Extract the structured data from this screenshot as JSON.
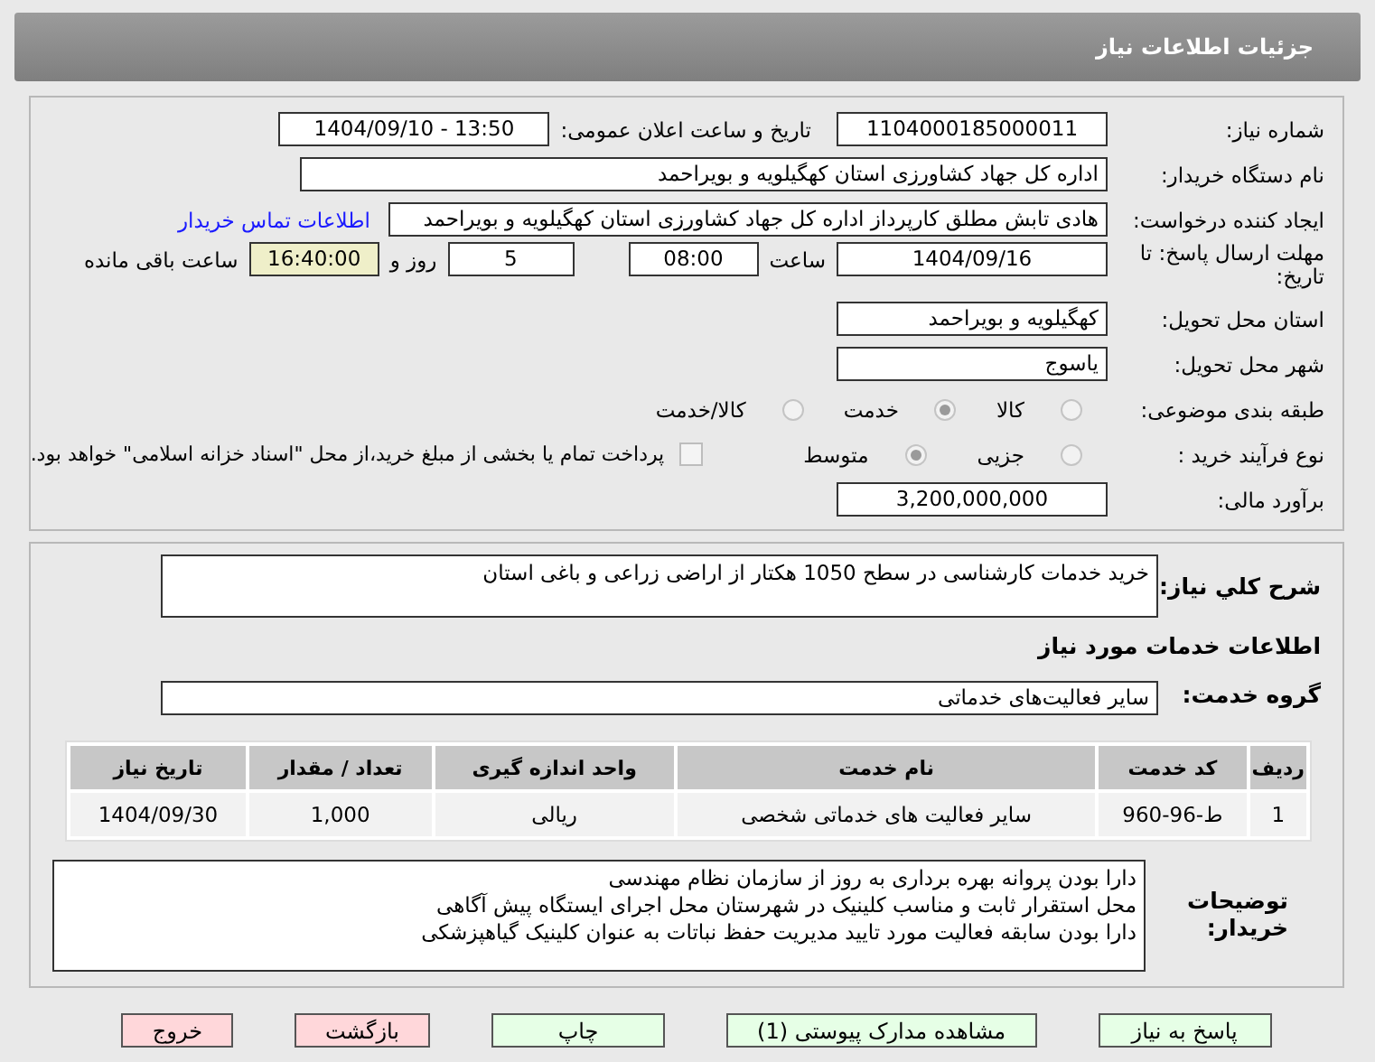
{
  "header": {
    "title": "جزئیات اطلاعات نیاز"
  },
  "need_number": {
    "label": "شماره نیاز:",
    "value": "1104000185000011"
  },
  "announce": {
    "label": "تاریخ و ساعت اعلان عمومی:",
    "value": "1404/09/10 - 13:50"
  },
  "buyer": {
    "label": "نام دستگاه خریدار:",
    "value": "اداره کل جهاد کشاورزی استان کهگیلویه و بویراحمد"
  },
  "creator": {
    "label": "ایجاد کننده درخواست:",
    "value": "هادی تابش مطلق کارپرداز اداره کل جهاد کشاورزی استان کهگیلویه و بویراحمد",
    "link": "اطلاعات تماس خریدار"
  },
  "deadline": {
    "label": "مهلت ارسال پاسخ: تا تاریخ:",
    "date": "1404/09/16",
    "time_label": "ساعت",
    "time": "08:00",
    "days": "5",
    "days_label": "روز و",
    "remaining": "16:40:00",
    "remaining_label": "ساعت باقی مانده"
  },
  "province": {
    "label": "استان محل تحویل:",
    "value": "کهگیلویه و بویراحمد"
  },
  "city": {
    "label": "شهر محل تحویل:",
    "value": "یاسوج"
  },
  "category": {
    "label": "طبقه بندی موضوعی:",
    "options": [
      {
        "label": "کالا",
        "selected": false
      },
      {
        "label": "خدمت",
        "selected": true
      },
      {
        "label": "کالا/خدمت",
        "selected": false
      }
    ]
  },
  "process": {
    "label": "نوع فرآیند خرید :",
    "options": [
      {
        "label": "جزیی",
        "selected": false
      },
      {
        "label": "متوسط",
        "selected": true
      }
    ],
    "treasury": {
      "checked": false,
      "text": "پرداخت تمام یا بخشی از مبلغ خرید،از محل \"اسناد خزانه اسلامی\" خواهد بود."
    }
  },
  "budget": {
    "label": "برآورد مالی:",
    "value": "3,200,000,000"
  },
  "summary": {
    "label": "شرح كلي نياز:",
    "value": "خرید خدمات کارشناسی در سطح 1050 هکتار از اراضی زراعی و باغی استان"
  },
  "services_title": "اطلاعات خدمات مورد نیاز",
  "service_group": {
    "label": "گروه خدمت:",
    "value": "سایر فعالیت‌های خدماتی"
  },
  "table": {
    "columns": [
      "ردیف",
      "کد خدمت",
      "نام خدمت",
      "واحد اندازه گیری",
      "تعداد / مقدار",
      "تاریخ نیاز"
    ],
    "rows": [
      [
        "1",
        "ط-96-960",
        "سایر فعالیت های خدماتی شخصی",
        "ریالی",
        "1,000",
        "1404/09/30"
      ]
    ]
  },
  "notes": {
    "label": "توضیحات خریدار:",
    "lines": [
      "دارا بودن پروانه بهره برداری به روز از سازمان نظام مهندسی",
      "محل استقرار ثابت و مناسب کلینیک در شهرستان محل اجرای ایستگاه پیش آگاهی",
      "دارا بودن سابقه فعالیت مورد تایید مدیریت حفظ نباتات به عنوان کلینیک گیاهپزشکی"
    ]
  },
  "buttons": [
    {
      "label": "پاسخ به نیاز",
      "kind": "green"
    },
    {
      "label": "مشاهده مدارک پیوستی (1)",
      "kind": "green"
    },
    {
      "label": "چاپ",
      "kind": "green"
    },
    {
      "label": "بازگشت",
      "kind": "red"
    },
    {
      "label": "خروج",
      "kind": "red"
    }
  ]
}
